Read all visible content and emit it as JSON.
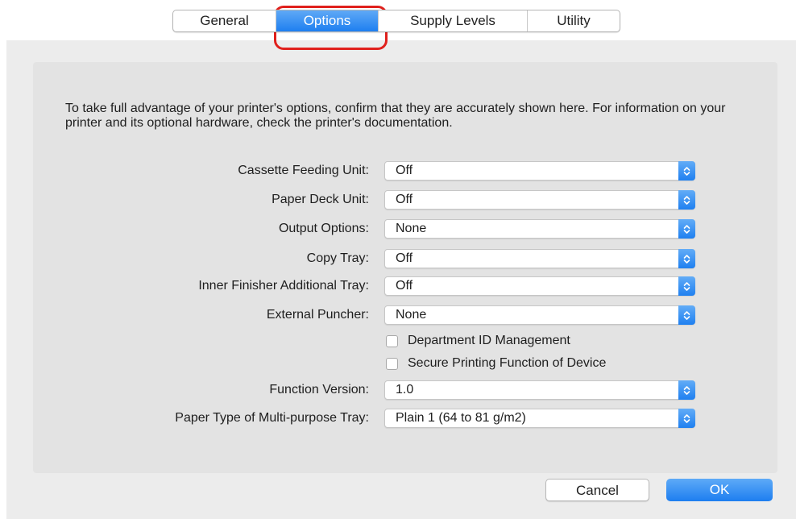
{
  "tabs": [
    "General",
    "Options",
    "Supply Levels",
    "Utility"
  ],
  "active_tab": "Options",
  "description": "To take full advantage of your printer's options, confirm that they are accurately shown here. For information on your printer and its optional hardware, check the printer's documentation.",
  "options": [
    {
      "label": "Cassette Feeding Unit:",
      "value": "Off"
    },
    {
      "label": "Paper Deck Unit:",
      "value": "Off"
    },
    {
      "label": "Output Options:",
      "value": "None"
    },
    {
      "label": "Copy Tray:",
      "value": "Off"
    },
    {
      "label": "Inner Finisher Additional Tray:",
      "value": "Off"
    },
    {
      "label": "External Puncher:",
      "value": "None"
    }
  ],
  "checkboxes": [
    {
      "label": "Department ID Management",
      "checked": false
    },
    {
      "label": "Secure Printing Function of Device",
      "checked": false
    }
  ],
  "function_version": {
    "label": "Function Version:",
    "value": "1.0"
  },
  "paper_type": {
    "label": "Paper Type of Multi-purpose Tray:",
    "value": "Plain 1 (64 to 81 g/m2)"
  },
  "buttons": {
    "cancel": "Cancel",
    "ok": "OK"
  },
  "colors": {
    "accent": "#1e7ff0",
    "highlight": "#e0201c"
  }
}
